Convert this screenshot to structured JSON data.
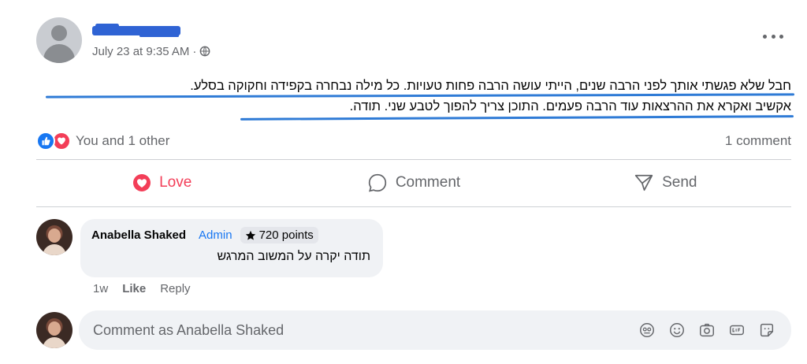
{
  "post": {
    "timestamp": "July 23 at 9:35 AM",
    "meta_separator": "·",
    "text_line1": "חבל שלא פגשתי אותך לפני הרבה שנים, הייתי עושה הרבה פחות טעויות. כל מילה נבחרה בקפידה וחקוקה בסלע.",
    "text_line2": "אקשיב ואקרא את ההרצאות עוד הרבה פעמים. התוכן צריך להפוך לטבע שני. תודה.",
    "reactions_text": "You and 1 other",
    "comment_count": "1 comment"
  },
  "actions": {
    "love_label": "Love",
    "comment_label": "Comment",
    "send_label": "Send"
  },
  "comment": {
    "author": "Anabella Shaked",
    "badge_role": "Admin",
    "points": "720 points",
    "text": "תודה יקרה על המשוב המרגש",
    "age": "1w",
    "like_label": "Like",
    "reply_label": "Reply"
  },
  "composer": {
    "placeholder": "Comment as Anabella Shaked"
  },
  "colors": {
    "accent_blue": "#1877f2",
    "love_red": "#f33e58",
    "secondary_text": "#65676b",
    "bubble_bg": "#f0f2f5"
  },
  "icons": [
    "globe-icon",
    "more-icon",
    "like-reaction-icon",
    "love-reaction-icon",
    "heart-icon",
    "comment-icon",
    "send-icon",
    "star-icon",
    "avatar-sticker-icon",
    "emoji-icon",
    "camera-icon",
    "gif-icon",
    "sticker-icon"
  ]
}
